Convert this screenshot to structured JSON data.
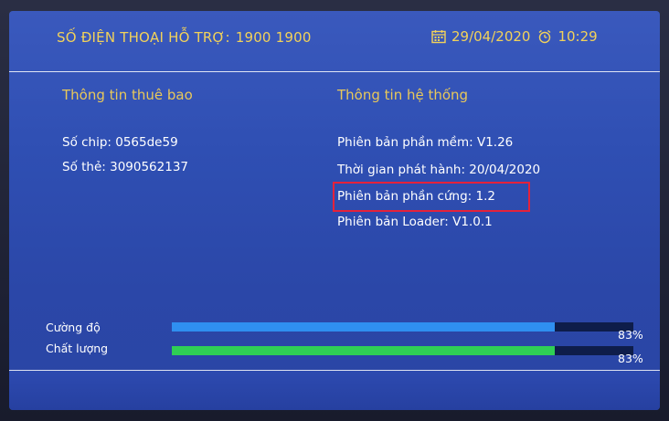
{
  "header": {
    "hotline_label": "SỐ ĐIỆN THOẠI HỖ TRỢ:",
    "hotline_number": "1900 1900",
    "date": "29/04/2020",
    "time": "10:29"
  },
  "subscriber": {
    "heading": "Thông tin thuê bao",
    "chip_id": "Số chip: 0565de59",
    "card_no": "Số thẻ: 3090562137"
  },
  "system": {
    "heading": "Thông tin hệ thống",
    "software_version": "Phiên bản phần mềm: V1.26",
    "release_date": "Thời gian phát hành: 20/04/2020",
    "hardware_version": "Phiên bản phần cứng: 1.2",
    "loader_version": "Phiên bản Loader: V1.0.1"
  },
  "signal": {
    "strength_label": "Cường độ",
    "strength_value": 83,
    "strength_percent": "83%",
    "quality_label": "Chất lượng",
    "quality_value": 83,
    "quality_percent": "83%"
  },
  "colors": {
    "screen_bg": "#2f4fb3",
    "accent_text": "#f2d25a",
    "highlight_box": "#e5223a",
    "strength_bar": "#2f8ff0",
    "quality_bar": "#2fcf55"
  },
  "icons": {
    "date": "calendar-icon",
    "time": "alarm-clock-icon"
  }
}
